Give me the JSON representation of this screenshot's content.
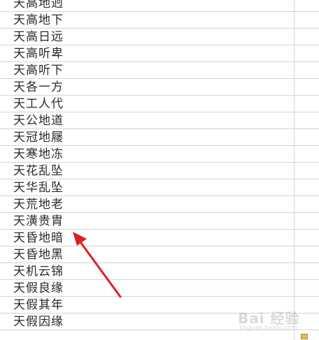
{
  "sheet": {
    "rows": [
      "天高地迥",
      "天高地下",
      "天高日远",
      "天高听卑",
      "天高听下",
      "天各一方",
      "天工人代",
      "天公地道",
      "天冠地屦",
      "天寒地冻",
      "天花乱坠",
      "天华乱坠",
      "天荒地老",
      "天潢贵胄",
      "天昏地暗",
      "天昏地黑",
      "天机云锦",
      "天假良缘",
      "天假其年",
      "天假因缘"
    ]
  },
  "annotation": {
    "arrow_color": "#e02020"
  },
  "watermark": {
    "brand": "Bai 经验",
    "sub": "jingyan.baidu.com"
  }
}
